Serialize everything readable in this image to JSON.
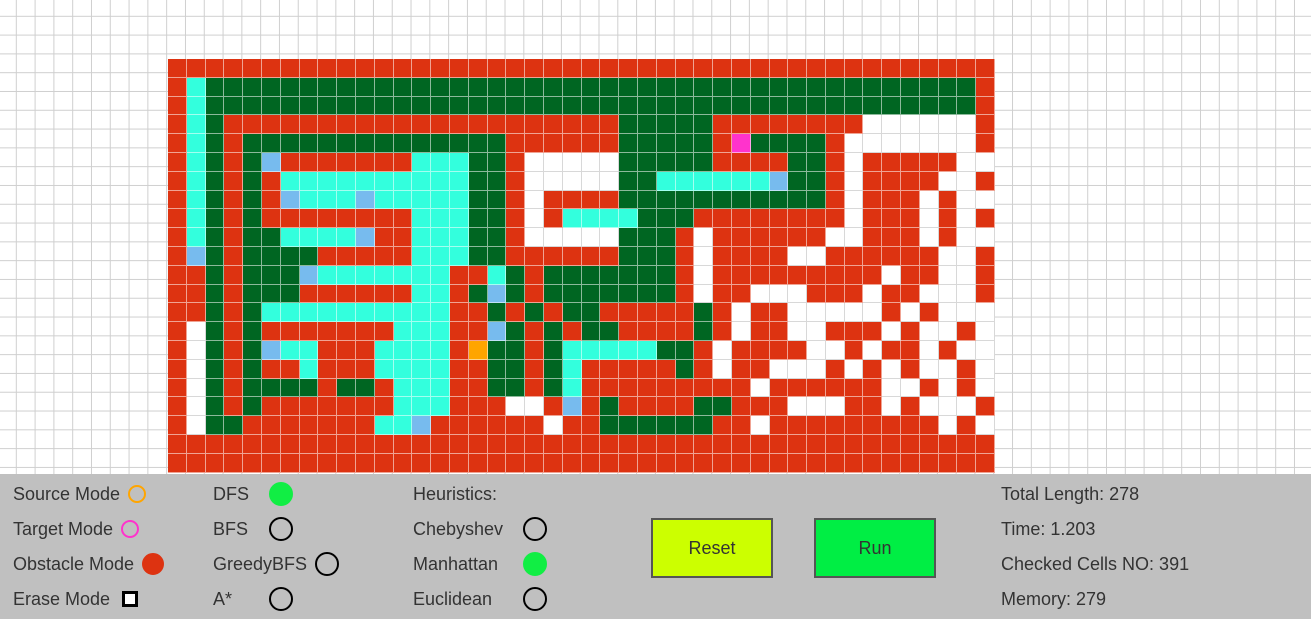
{
  "grid": {
    "rows": [
      "RRRRRRRRRRRRRRRRRRRRRRRRRRRRRRRRRRRRRRRRRRRR",
      "RCGGGGGGGGGGGGGGGGGGGGGGGGGGGGGGGGGGGGGGGGGR",
      "RCGGGGGGGGGGGGGGGGGGGGGGGGGGGGGGGGGGGGGGGGGR",
      "RCGRRRRRRRRRRRRRRRRRRRRRGGGGGRRRRRRRREEEEEER",
      "RCGRGGGGGGGGGGGGGGRRRRRRGGGGGRTGGGGREEEEEEER",
      "RCGRGBRRRRRRRCCCGGREEEEEGGGGGRRRRGGRERRRRREER",
      "RCGRGRCCCCCCCCCCGGREEEEEGGCCCCCCBGGRERRRREER",
      "RCGRGRBCCCBCCCCCGGRERRRRGGGGGGGGGGGRERRREREER",
      "RCGRGRRRRRRRRCCCGGRERCCCCGGGRRRRRRRRERRRERERR",
      "RCGRGGCCCCBRRCCCGGREEEEEGGGRERRRRRREERRREREERR",
      "RBGRGGGGRRRRRCCCGGRRRRRRGGGRERRRREERRRRRREERR",
      "RRGRGGGBCCCCCCCRRCGRGGGGGGGRERRRRRRRRRERREER",
      "RRGRGGGRRRRRRCCRGBGRGGGGGGGRERREEERRRERREEER",
      "RRGRGCCCCCCCCCCRRGRGRGGRRRRRGRERREEEEEREREEER",
      "REGRGRRRRRRRCCCRRBGRGRGGRRRRGRERREERRREREERER",
      "REGRGBCCRRRCCCCRSGGRGCCCCCGGRERRRREERERREREER",
      "REGRGRRCRRRCCCCRRGGRGCRRRRRGRERREEEREREREERER",
      "REGRGGGGRGGRCCCRRGGRGCRRRRRRRRRERRRRRREERERER",
      "REGRGRRRRRRRCCCRRREERBRGRRRRGGRRREEERREREEER",
      "REGGRRRRRRRCCBRRRRRRERRGGGGGGRRERRRRRRRRRERER",
      "RRRRRRRRRRRRRRRRRRRRRRRRRRRRRRRRRRRRRRRRRRRR",
      "RRRRRRRRRRRRRRRRRRRRRRRRRRRRRRRRRRRRRRRRRRRR"
    ],
    "legend": {
      "E": "#ffffff",
      "R": "#dd3311",
      "G": "#006622",
      "C": "#33ffdd",
      "B": "#77bbee",
      "S": "#ffa500",
      "T": "#ff33cc"
    }
  },
  "modes": [
    {
      "label": "Source Mode",
      "indicator": "orange-ring"
    },
    {
      "label": "Target Mode",
      "indicator": "pink-ring"
    },
    {
      "label": "Obstacle Mode",
      "indicator": "red-dot"
    },
    {
      "label": "Erase Mode",
      "indicator": "square"
    }
  ],
  "algorithms": [
    {
      "label": "DFS",
      "selected": true
    },
    {
      "label": "BFS",
      "selected": false
    },
    {
      "label": "GreedyBFS",
      "selected": false
    },
    {
      "label": "A*",
      "selected": false
    }
  ],
  "heuristics": {
    "title": "Heuristics:",
    "items": [
      {
        "label": "Chebyshev",
        "selected": false
      },
      {
        "label": "Manhattan",
        "selected": true
      },
      {
        "label": "Euclidean",
        "selected": false
      }
    ]
  },
  "buttons": {
    "reset": "Reset",
    "run": "Run"
  },
  "stats": {
    "total_length": "Total Length: 278",
    "time": "Time: 1.203",
    "checked_cells": "Checked Cells NO: 391",
    "memory": "Memory: 279"
  },
  "colors": {
    "selected_green": "#11ee44",
    "obstacle_red": "#dd3311",
    "source_orange": "#ffa500",
    "target_pink": "#ff33cc",
    "reset_button": "#ccff00",
    "run_button": "#00ee44",
    "panel_bg": "#c0c0c0"
  }
}
